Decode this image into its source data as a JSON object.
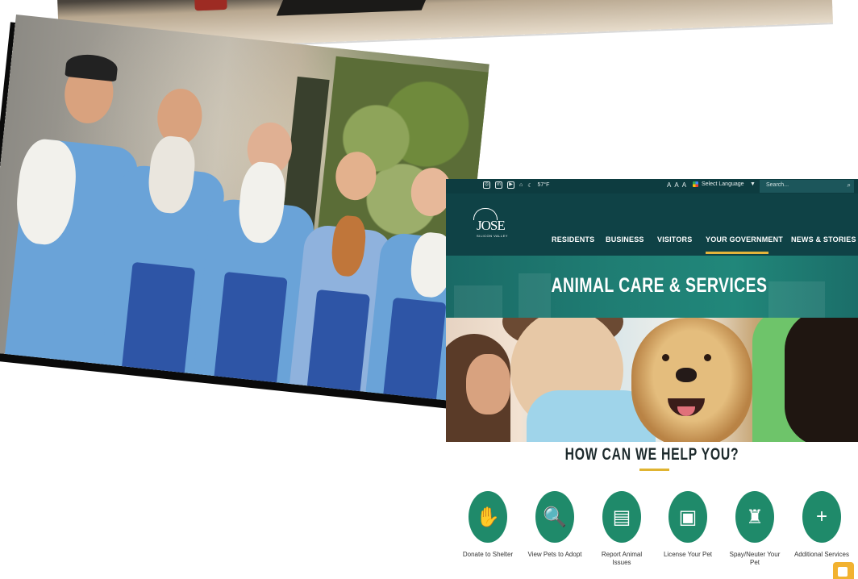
{
  "site": {
    "utility": {
      "social": [
        "instagram-icon",
        "linkedin-icon",
        "youtube-icon",
        "home-icon",
        "moon-icon"
      ],
      "weather": "57°F",
      "font_size_controls": [
        "A",
        "A",
        "A"
      ],
      "language_label": "Select Language",
      "language_caret": "▼",
      "search_placeholder": "Search..."
    },
    "logo": {
      "word": "JOSE",
      "sub": "SILICON VALLEY"
    },
    "nav": {
      "items": [
        "RESIDENTS",
        "BUSINESS",
        "VISITORS",
        "YOUR GOVERNMENT",
        "NEWS & STORIES"
      ],
      "active": "YOUR GOVERNMENT",
      "accent": "#e5b43a"
    },
    "banner": {
      "title": "ANIMAL CARE & SERVICES"
    },
    "help": {
      "title": "HOW CAN WE HELP YOU?",
      "services": [
        {
          "label": "Donate to Shelter",
          "icon": "hand-icon",
          "glyph": "✋"
        },
        {
          "label": "View Pets to Adopt",
          "icon": "magnifier-icon",
          "glyph": "🔍"
        },
        {
          "label": "Report Animal Issues",
          "icon": "report-icon",
          "glyph": "▤"
        },
        {
          "label": "License Your Pet",
          "icon": "license-icon",
          "glyph": "▣"
        },
        {
          "label": "Spay/Neuter Your Pet",
          "icon": "clinic-icon",
          "glyph": "♜"
        },
        {
          "label": "Additional Services",
          "icon": "plus-icon",
          "glyph": "+"
        }
      ]
    }
  },
  "colors": {
    "nav_bg": "#0f4246",
    "banner_bg": "#1f7d73",
    "service_green": "#1f8a6a",
    "apron_blue": "#2e55a6"
  }
}
